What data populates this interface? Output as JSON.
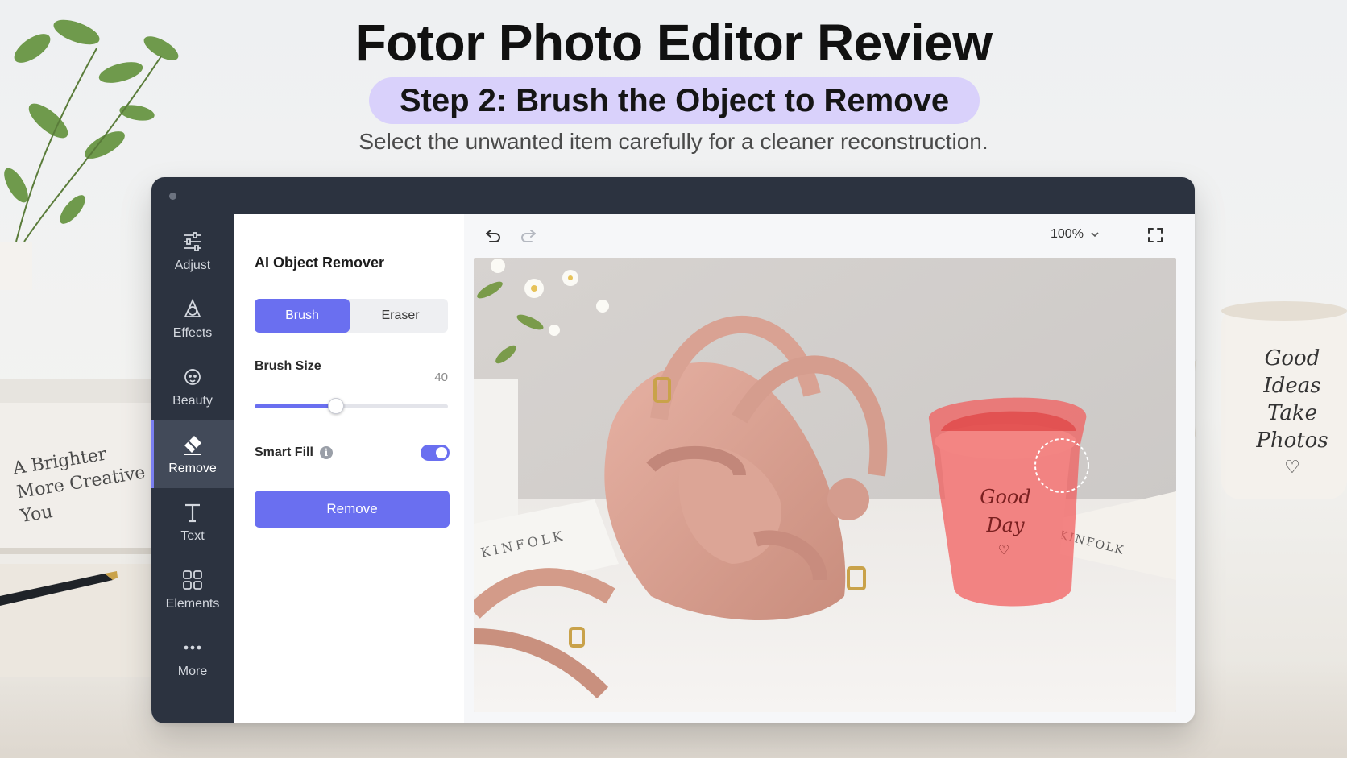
{
  "header": {
    "title": "Fotor Photo Editor Review",
    "step": "Step 2: Brush the Object to Remove",
    "subtitle": "Select the unwanted item carefully for a cleaner reconstruction."
  },
  "background": {
    "book_text": [
      "A Brighter",
      "More Creative",
      "You"
    ],
    "mug_text": [
      "Good",
      "Ideas",
      "Take",
      "Photos"
    ]
  },
  "rail": {
    "items": [
      {
        "label": "Adjust",
        "icon": "sliders-icon"
      },
      {
        "label": "Effects",
        "icon": "effects-icon"
      },
      {
        "label": "Beauty",
        "icon": "beauty-icon"
      },
      {
        "label": "Remove",
        "icon": "eraser-icon",
        "active": true
      },
      {
        "label": "Text",
        "icon": "text-icon"
      },
      {
        "label": "Elements",
        "icon": "grid-icon"
      },
      {
        "label": "More",
        "icon": "more-icon"
      }
    ]
  },
  "panel": {
    "title": "AI Object Remover",
    "mode_brush": "Brush",
    "mode_eraser": "Eraser",
    "active_mode": "Brush",
    "brush_size_label": "Brush Size",
    "brush_size_value": "40",
    "brush_size_fraction": 0.42,
    "smart_fill_label": "Smart Fill",
    "smart_fill_on": true,
    "remove_label": "Remove"
  },
  "toolbar": {
    "zoom": "100%"
  },
  "canvas": {
    "cup_text": [
      "Good",
      "Day"
    ],
    "book_spine_text": "KINFOLK",
    "book_spine_text_2": "KINFOLK"
  },
  "colors": {
    "accent": "#6a6ff0",
    "rail_bg": "#2c3340",
    "mask": "#f25a5a",
    "pill": "#d9d1fb"
  }
}
